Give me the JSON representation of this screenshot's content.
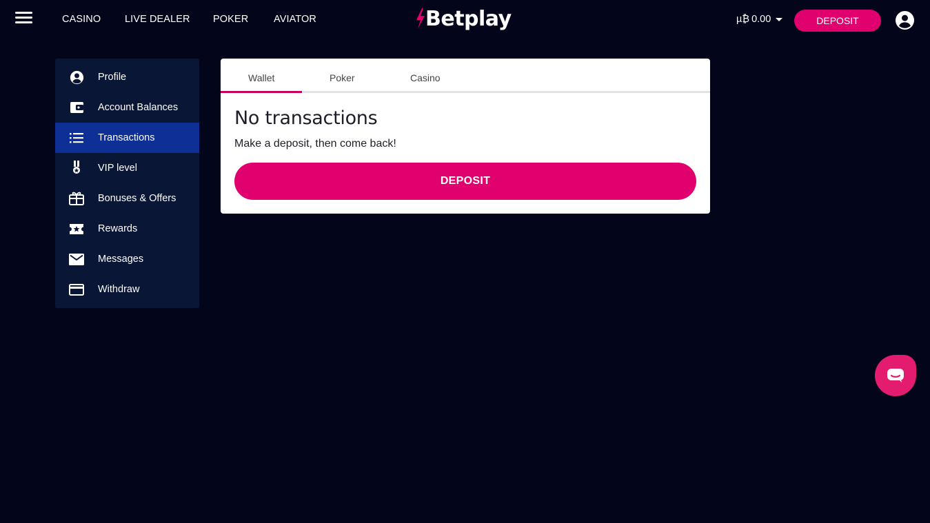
{
  "header": {
    "nav": [
      "CASINO",
      "LIVE DEALER",
      "POKER",
      "AVIATOR"
    ],
    "logo_text": "Betplay",
    "balance_currency": "µ₿",
    "balance_value": "0.00",
    "deposit_label": "DEPOSIT"
  },
  "sidebar": {
    "items": [
      {
        "label": "Profile",
        "icon": "user-circle-icon"
      },
      {
        "label": "Account Balances",
        "icon": "wallet-icon"
      },
      {
        "label": "Transactions",
        "icon": "list-icon",
        "active": true
      },
      {
        "label": "VIP level",
        "icon": "medal-icon"
      },
      {
        "label": "Bonuses & Offers",
        "icon": "gift-icon"
      },
      {
        "label": "Rewards",
        "icon": "ticket-star-icon"
      },
      {
        "label": "Messages",
        "icon": "mail-icon"
      },
      {
        "label": "Withdraw",
        "icon": "credit-card-icon"
      }
    ]
  },
  "main": {
    "tabs": [
      "Wallet",
      "Poker",
      "Casino"
    ],
    "active_tab": "Wallet",
    "empty_title": "No transactions",
    "empty_message": "Make a deposit, then come back!",
    "deposit_label": "DEPOSIT"
  },
  "colors": {
    "accent": "#e0006e",
    "background": "#03051a",
    "sidebar_bg": "#0a1635",
    "sidebar_active": "#0d2f96"
  }
}
